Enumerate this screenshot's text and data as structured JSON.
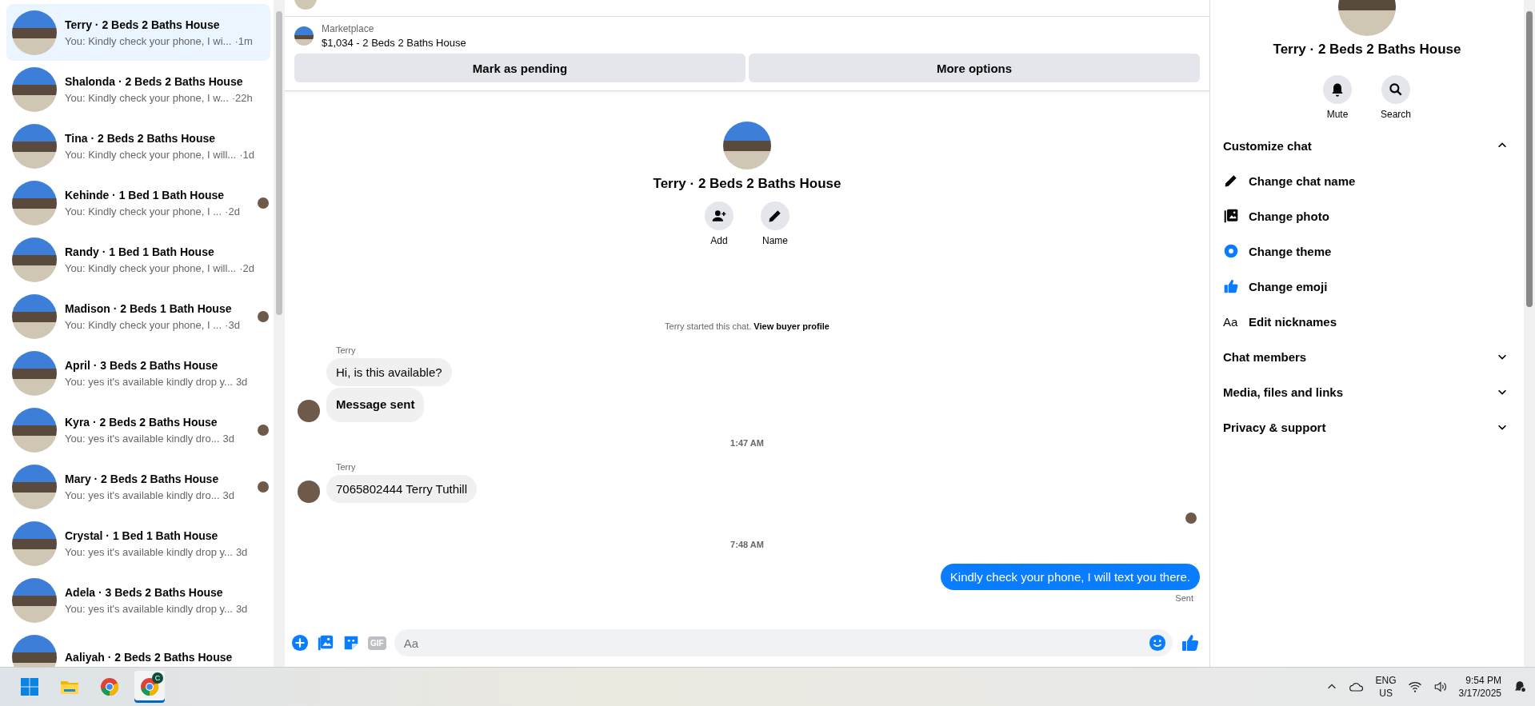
{
  "conversations": [
    {
      "name": "Terry · 2 Beds 2 Baths House",
      "preview": "You: Kindly check your phone, I wi...",
      "time": "·1m",
      "selected": true,
      "seen": false
    },
    {
      "name": "Shalonda · 2 Beds 2 Baths House",
      "preview": "You: Kindly check your phone, I w...",
      "time": "·22h",
      "selected": false,
      "seen": false
    },
    {
      "name": "Tina · 2 Beds 2 Baths House",
      "preview": "You: Kindly check your phone, I will...",
      "time": "·1d",
      "selected": false,
      "seen": false
    },
    {
      "name": "Kehinde · 1 Bed 1 Bath House",
      "preview": "You: Kindly check your phone, I ...",
      "time": "·2d",
      "selected": false,
      "seen": true
    },
    {
      "name": "Randy · 1 Bed 1 Bath House",
      "preview": "You: Kindly check your phone, I will...",
      "time": "·2d",
      "selected": false,
      "seen": false
    },
    {
      "name": "Madison · 2 Beds 1 Bath House",
      "preview": "You: Kindly check your phone, I ...",
      "time": "·3d",
      "selected": false,
      "seen": true
    },
    {
      "name": "April · 3 Beds 2 Baths House",
      "preview": "You: yes it's available kindly drop y...",
      "time": "3d",
      "selected": false,
      "seen": false
    },
    {
      "name": "Kyra · 2 Beds 2 Baths House",
      "preview": "You: yes it's available kindly dro...",
      "time": "3d",
      "selected": false,
      "seen": true
    },
    {
      "name": "Mary · 2 Beds 2 Baths House",
      "preview": "You: yes it's available kindly dro...",
      "time": "3d",
      "selected": false,
      "seen": true
    },
    {
      "name": "Crystal · 1 Bed 1 Bath House",
      "preview": "You: yes it's available kindly drop y...",
      "time": "3d",
      "selected": false,
      "seen": false
    },
    {
      "name": "Adela · 3 Beds 2 Baths House",
      "preview": "You: yes it's available kindly drop y...",
      "time": "3d",
      "selected": false,
      "seen": false
    },
    {
      "name": "Aaliyah · 2 Beds 2 Baths House",
      "selected": false,
      "seen": false
    }
  ],
  "listing": {
    "label": "Marketplace",
    "title": "$1,034 - 2 Beds 2 Baths House",
    "actions": [
      "Mark as pending",
      "More options"
    ]
  },
  "chat_header": {
    "title": "Terry · 2 Beds 2 Baths House",
    "actions": [
      {
        "kind": "add",
        "label": "Add"
      },
      {
        "kind": "name",
        "label": "Name"
      }
    ]
  },
  "notice": {
    "text": "Terry started this chat.",
    "link": "View buyer profile"
  },
  "messages": [
    {
      "kind": "sender",
      "text": "Terry"
    },
    {
      "kind": "incoming",
      "text": "Hi, is this available?",
      "avatar": false,
      "bold": false
    },
    {
      "kind": "incoming",
      "text": "Message sent",
      "avatar": true,
      "bold": true
    },
    {
      "kind": "time",
      "text": "1:47 AM"
    },
    {
      "kind": "sender",
      "text": "Terry"
    },
    {
      "kind": "incoming",
      "text": "7065802444 Terry Tuthill",
      "avatar": true,
      "bold": false
    },
    {
      "kind": "seen"
    },
    {
      "kind": "time",
      "text": "7:48 AM"
    },
    {
      "kind": "outgoing",
      "text": "Kindly check your phone, I will text you there."
    },
    {
      "kind": "status",
      "text": "Sent"
    }
  ],
  "composer": {
    "placeholder": "Aa",
    "tools": [
      {
        "kind": "plus"
      },
      {
        "kind": "image"
      },
      {
        "kind": "sticker"
      },
      {
        "kind": "gif",
        "label": "GIF"
      }
    ]
  },
  "details": {
    "title": "Terry · 2 Beds 2 Baths House",
    "actions": [
      {
        "kind": "mute",
        "label": "Mute"
      },
      {
        "kind": "search",
        "label": "Search"
      }
    ],
    "sections": [
      {
        "title": "Customize chat",
        "expanded": true,
        "items": [
          {
            "kind": "pencil",
            "label": "Change chat name"
          },
          {
            "kind": "photo",
            "label": "Change photo"
          },
          {
            "kind": "theme",
            "label": "Change theme"
          },
          {
            "kind": "like",
            "label": "Change emoji"
          },
          {
            "kind": "text",
            "icon_text": "Aa",
            "label": "Edit nicknames"
          }
        ]
      },
      {
        "title": "Chat members",
        "expanded": false
      },
      {
        "title": "Media, files and links",
        "expanded": false
      },
      {
        "title": "Privacy & support",
        "expanded": false
      }
    ]
  },
  "taskbar": {
    "apps": [
      {
        "kind": "start",
        "selected": false
      },
      {
        "kind": "folder",
        "selected": false
      },
      {
        "kind": "chrome",
        "selected": false
      },
      {
        "kind": "chrome",
        "badge": "C",
        "selected": true
      }
    ],
    "language": [
      "ENG",
      "US"
    ],
    "time": "9:54 PM",
    "date": "3/17/2025"
  }
}
